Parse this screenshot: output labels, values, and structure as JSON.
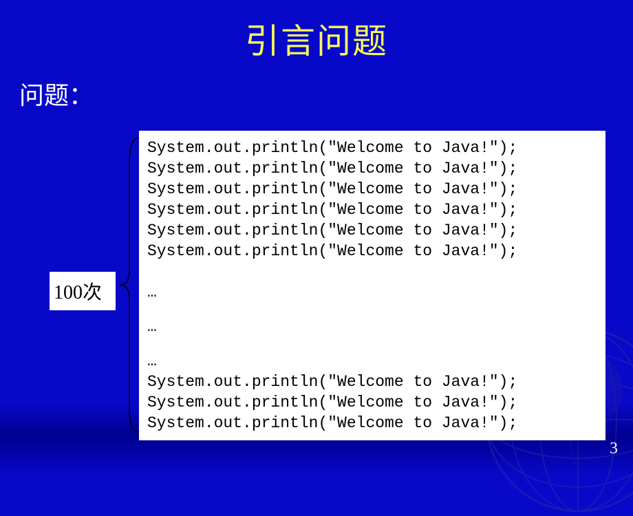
{
  "slide": {
    "title": "引言问题",
    "section_label": "问题：",
    "count_label": "100次",
    "page_number": "3"
  },
  "code": {
    "line1": "System.out.println(\"Welcome to Java!\");",
    "line2": "System.out.println(\"Welcome to Java!\");",
    "line3": "System.out.println(\"Welcome to Java!\");",
    "line4": "System.out.println(\"Welcome to Java!\");",
    "line5": "System.out.println(\"Welcome to Java!\");",
    "line6": "System.out.println(\"Welcome to Java!\");",
    "ellipsis1": "…",
    "ellipsis2": "…",
    "ellipsis3": "…",
    "line7": "System.out.println(\"Welcome to Java!\");",
    "line8": "System.out.println(\"Welcome to Java!\");",
    "line9": "System.out.println(\"Welcome to Java!\");"
  }
}
